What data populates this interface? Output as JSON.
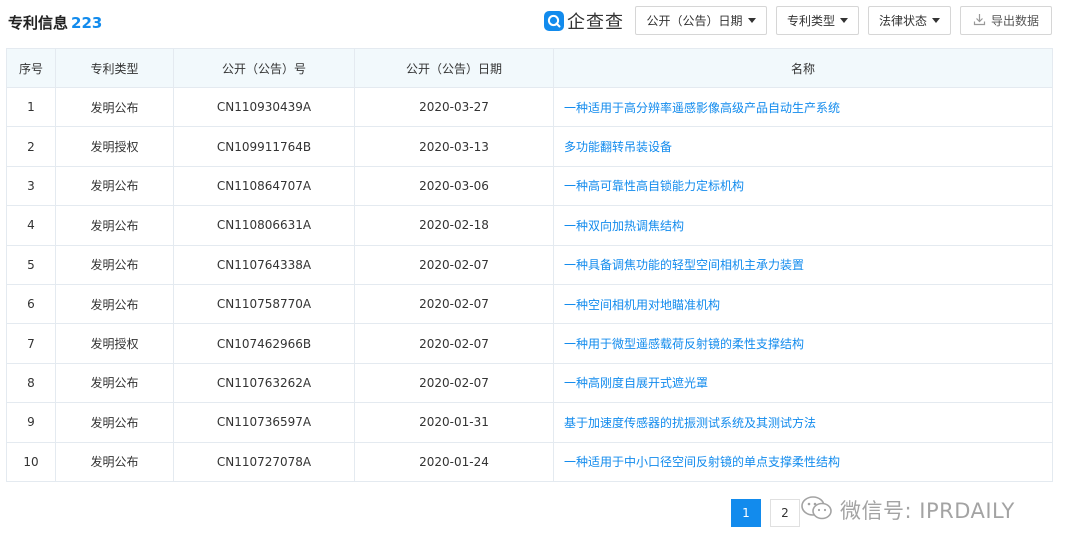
{
  "header": {
    "title": "专利信息",
    "count": "223",
    "logo_text": "企查查",
    "filters": {
      "date": "公开（公告）日期",
      "type": "专利类型",
      "legal": "法律状态"
    },
    "export_label": "导出数据",
    "icons": {
      "logo": "qichacha-logo-icon",
      "export": "download-icon",
      "caret": "caret-down-icon"
    }
  },
  "table": {
    "columns": [
      "序号",
      "专利类型",
      "公开（公告）号",
      "公开（公告）日期",
      "名称"
    ],
    "rows": [
      {
        "no": "1",
        "type": "发明公布",
        "pub_no": "CN110930439A",
        "date": "2020-03-27",
        "name": "一种适用于高分辨率遥感影像高级产品自动生产系统"
      },
      {
        "no": "2",
        "type": "发明授权",
        "pub_no": "CN109911764B",
        "date": "2020-03-13",
        "name": "多功能翻转吊装设备"
      },
      {
        "no": "3",
        "type": "发明公布",
        "pub_no": "CN110864707A",
        "date": "2020-03-06",
        "name": "一种高可靠性高自锁能力定标机构"
      },
      {
        "no": "4",
        "type": "发明公布",
        "pub_no": "CN110806631A",
        "date": "2020-02-18",
        "name": "一种双向加热调焦结构"
      },
      {
        "no": "5",
        "type": "发明公布",
        "pub_no": "CN110764338A",
        "date": "2020-02-07",
        "name": "一种具备调焦功能的轻型空间相机主承力装置"
      },
      {
        "no": "6",
        "type": "发明公布",
        "pub_no": "CN110758770A",
        "date": "2020-02-07",
        "name": "一种空间相机用对地瞄准机构"
      },
      {
        "no": "7",
        "type": "发明授权",
        "pub_no": "CN107462966B",
        "date": "2020-02-07",
        "name": "一种用于微型遥感载荷反射镜的柔性支撑结构"
      },
      {
        "no": "8",
        "type": "发明公布",
        "pub_no": "CN110763262A",
        "date": "2020-02-07",
        "name": "一种高刚度自展开式遮光罩"
      },
      {
        "no": "9",
        "type": "发明公布",
        "pub_no": "CN110736597A",
        "date": "2020-01-31",
        "name": "基于加速度传感器的扰振测试系统及其测试方法"
      },
      {
        "no": "10",
        "type": "发明公布",
        "pub_no": "CN110727078A",
        "date": "2020-01-24",
        "name": "一种适用于中小口径空间反射镜的单点支撑柔性结构"
      }
    ]
  },
  "pagination": {
    "current": "1",
    "pages": [
      "1",
      "2"
    ]
  },
  "watermark": {
    "text": "微信号: IPRDAILY",
    "icon": "wechat-icon"
  },
  "colors": {
    "accent": "#128bed",
    "header_bg": "#f2f9fc",
    "border": "#e4eaf0"
  }
}
